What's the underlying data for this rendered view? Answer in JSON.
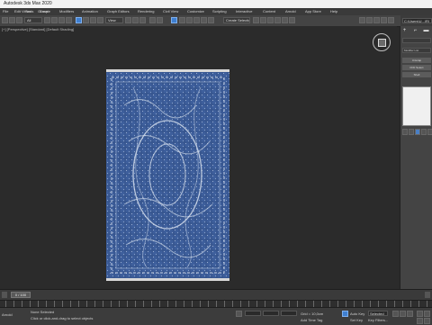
{
  "window": {
    "title": "Autodesk 3ds Max 2020"
  },
  "menu": [
    "File",
    "Edit",
    "Tools",
    "Group",
    "Views",
    "Create",
    "Modifiers",
    "Animation",
    "Graph Editors",
    "Rendering",
    "Civil View",
    "Customize",
    "Scripting",
    "Interactive",
    "Content",
    "Arnold",
    "App Store",
    "Help"
  ],
  "toolbar": {
    "filter_value": "All",
    "reference_coord": "View",
    "selection_set": "Create Selection Se"
  },
  "workspace": {
    "label": "C:\\Users\\U...\\Rl"
  },
  "viewport": {
    "label": "[+] [Perspective] [Standard] [Default Shading]",
    "rug_colors": {
      "base": "#3e5f9c",
      "pattern": "#dfe7f2",
      "fringe": "#e8e8e8"
    }
  },
  "command_panel": {
    "tabs": [
      "+",
      "⌐",
      "▬",
      "◉",
      "▭",
      "🔧"
    ],
    "name_field": "",
    "modifier_list": "Modifier List",
    "buttons": [
      "Unwrap",
      "FFD Select",
      "Shell"
    ],
    "icons": [
      "pin-icon",
      "stack-icon",
      "unique-icon",
      "delete-icon",
      "configure-icon"
    ]
  },
  "timeline": {
    "frame": "0 / 100"
  },
  "status": {
    "script_label": "Arnold",
    "selection": "None Selected",
    "prompt": "Click or click-and-drag to select objects",
    "grid": "Grid = 10,0cm",
    "add_time_tag": "Add Time Tag",
    "auto_key": "Auto Key",
    "set_key": "Set Key",
    "selected": "Selected",
    "key_filters": "Key Filters..."
  }
}
